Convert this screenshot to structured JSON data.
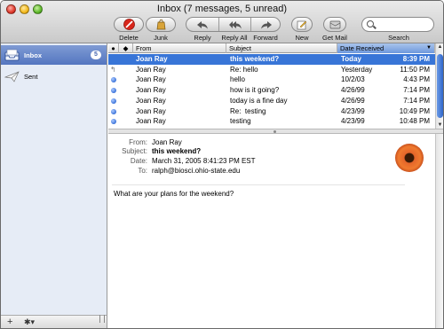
{
  "window": {
    "title": "Inbox (7 messages, 5 unread)"
  },
  "toolbar": {
    "delete": "Delete",
    "junk": "Junk",
    "reply": "Reply",
    "reply_all": "Reply All",
    "forward": "Forward",
    "new": "New",
    "get_mail": "Get Mail",
    "search": "Search",
    "search_placeholder": ""
  },
  "sidebar": {
    "items": [
      {
        "label": "Inbox",
        "badge": "5",
        "icon": "inbox-tray-icon"
      },
      {
        "label": "Sent",
        "icon": "paper-plane-icon"
      }
    ]
  },
  "list": {
    "columns": [
      "From",
      "Subject",
      "Date Received"
    ],
    "rows": [
      {
        "status": "",
        "from": "Joan Ray",
        "subject": "this weekend?",
        "date": "Today",
        "time": "8:39 PM"
      },
      {
        "status": "replied",
        "from": "Joan Ray",
        "subject": "Re: hello",
        "date": "Yesterday",
        "time": "11:50 PM"
      },
      {
        "status": "unread",
        "from": "Joan Ray",
        "subject": "hello",
        "date": "10/2/03",
        "time": "4:43 PM"
      },
      {
        "status": "unread",
        "from": "Joan Ray",
        "subject": "how is it going?",
        "date": "4/26/99",
        "time": "7:14 PM"
      },
      {
        "status": "unread",
        "from": "Joan Ray",
        "subject": "today is a fine day",
        "date": "4/26/99",
        "time": "7:14 PM"
      },
      {
        "status": "unread",
        "from": "Joan Ray",
        "subject": "Re:  testing",
        "date": "4/23/99",
        "time": "10:49 PM"
      },
      {
        "status": "unread",
        "from": "Joan Ray",
        "subject": "testing",
        "date": "4/23/99",
        "time": "10:48 PM"
      }
    ]
  },
  "message": {
    "from_label": "From:",
    "from": "Joan Ray",
    "subject_label": "Subject:",
    "subject": "this weekend?",
    "date_label": "Date:",
    "date": "March 31, 2005 8:41:23 PM EST",
    "to_label": "To:",
    "to": "ralph@biosci.ohio-state.edu",
    "body": "What are your plans for the weekend?"
  },
  "colors": {
    "selection": "#3875d7",
    "unread_dot": "#3b73d9",
    "sidebar_bg": "#e6ecf6"
  }
}
